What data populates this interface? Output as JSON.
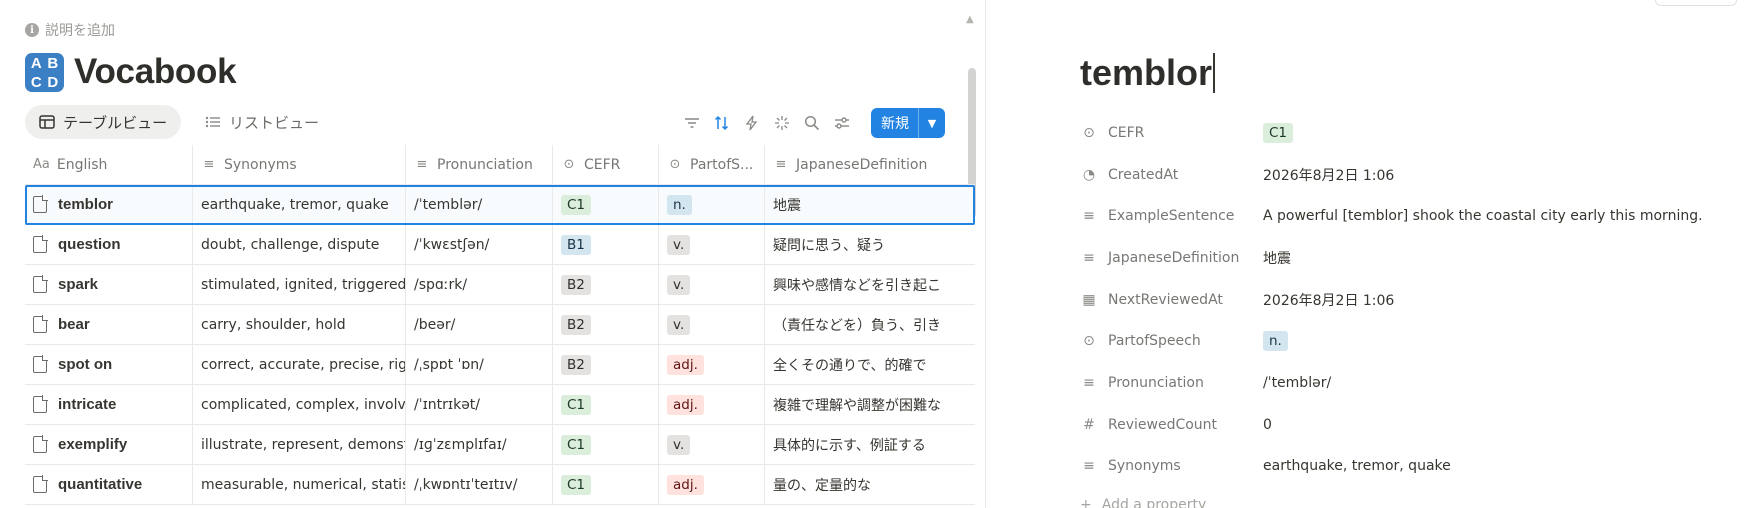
{
  "database": {
    "description": "説明を追加",
    "title": "Vocabook",
    "icon_letters": [
      "A",
      "B",
      "C",
      "D"
    ],
    "views": [
      {
        "label": "テーブルビュー",
        "icon": "table-icon",
        "active": true
      },
      {
        "label": "リストビュー",
        "icon": "list-icon",
        "active": false
      }
    ],
    "toolbar": {
      "new_label": "新規",
      "icons": [
        "filter-icon",
        "sort-icon",
        "automation-icon",
        "ai-sparkle-icon",
        "search-icon",
        "settings-sliders-icon"
      ]
    },
    "columns": [
      {
        "label": "English",
        "icon": "Aa"
      },
      {
        "label": "Synonyms",
        "icon": "text-icon"
      },
      {
        "label": "Pronunciation",
        "icon": "text-icon"
      },
      {
        "label": "CEFR",
        "icon": "select-icon"
      },
      {
        "label": "PartofS...",
        "icon": "select-icon"
      },
      {
        "label": "JapaneseDefinition",
        "icon": "text-icon"
      }
    ],
    "rows": [
      {
        "english": "temblor",
        "synonyms": "earthquake, tremor, quake",
        "pronunciation": "/ˈtemblər/",
        "cefr": "C1",
        "pos": "n.",
        "japanese": "地震"
      },
      {
        "english": "question",
        "synonyms": "doubt, challenge, dispute",
        "pronunciation": "/ˈkwɛstʃən/",
        "cefr": "B1",
        "pos": "v.",
        "japanese": "疑問に思う、疑う"
      },
      {
        "english": "spark",
        "synonyms": "stimulated, ignited, triggered, st",
        "pronunciation": "/spɑːrk/",
        "cefr": "B2",
        "pos": "v.",
        "japanese": "興味や感情などを引き起こ"
      },
      {
        "english": "bear",
        "synonyms": "carry, shoulder, hold",
        "pronunciation": "/beər/",
        "cefr": "B2",
        "pos": "v.",
        "japanese": "（責任などを）負う、引き"
      },
      {
        "english": "spot on",
        "synonyms": "correct, accurate, precise, right",
        "pronunciation": "/ˌspɒt ˈɒn/",
        "cefr": "B2",
        "pos": "adj.",
        "japanese": "全くその通りで、的確で"
      },
      {
        "english": "intricate",
        "synonyms": "complicated, complex, involved",
        "pronunciation": "/ˈɪntrɪkət/",
        "cefr": "C1",
        "pos": "adj.",
        "japanese": "複雑で理解や調整が困難な"
      },
      {
        "english": "exemplify",
        "synonyms": "illustrate, represent, demonstra",
        "pronunciation": "/ɪɡˈzɛmplɪfaɪ/",
        "cefr": "C1",
        "pos": "v.",
        "japanese": "具体的に示す、例証する"
      },
      {
        "english": "quantitative",
        "synonyms": "measurable, numerical, statistic",
        "pronunciation": "/ˌkwɒntɪˈteɪtɪv/",
        "cefr": "C1",
        "pos": "adj.",
        "japanese": "量の、定量的な"
      }
    ]
  },
  "page": {
    "title": "temblor",
    "properties": [
      {
        "name": "CEFR",
        "icon": "select-icon",
        "value": "C1",
        "type": "tag",
        "tag": "c1v"
      },
      {
        "name": "CreatedAt",
        "icon": "clock-icon",
        "value": "2026年8月2日 1:06",
        "type": "text"
      },
      {
        "name": "ExampleSentence",
        "icon": "text-icon",
        "value": "A powerful [temblor] shook the coastal city early this morning.",
        "type": "text"
      },
      {
        "name": "JapaneseDefinition",
        "icon": "text-icon",
        "value": "地震",
        "type": "text"
      },
      {
        "name": "NextReviewedAt",
        "icon": "calendar-icon",
        "value": "2026年8月2日 1:06",
        "type": "text"
      },
      {
        "name": "PartofSpeech",
        "icon": "select-icon",
        "value": "n.",
        "type": "tag",
        "tag": "n"
      },
      {
        "name": "Pronunciation",
        "icon": "text-icon",
        "value": "/ˈtemblər/",
        "type": "text"
      },
      {
        "name": "ReviewedCount",
        "icon": "number-icon",
        "value": "0",
        "type": "text"
      },
      {
        "name": "Synonyms",
        "icon": "text-icon",
        "value": "earthquake, tremor, quake",
        "type": "text"
      }
    ],
    "add_property": "Add a property"
  },
  "colors": {
    "accent": "#2383e2",
    "title_icon": "#3b7fc4",
    "tag_green": "#dbeddb",
    "tag_blue": "#d3e5ef",
    "tag_gray": "#e3e2e0",
    "tag_red": "#ffe2dd"
  }
}
